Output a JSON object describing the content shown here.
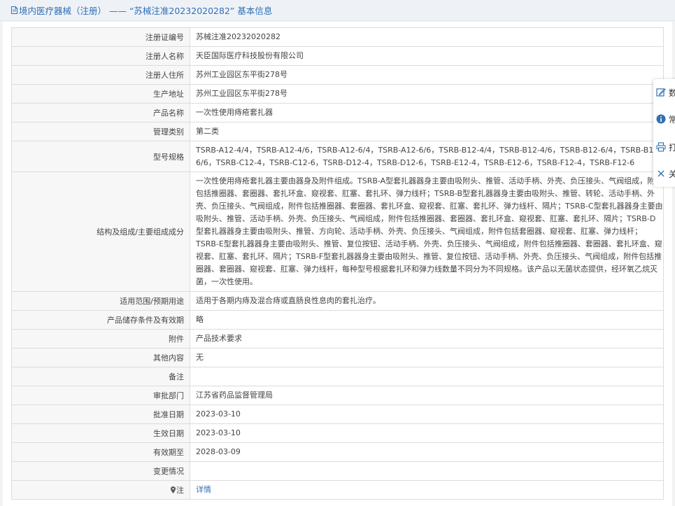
{
  "header": {
    "title": "境内医疗器械（注册） —— “苏械注准20232020282” 基本信息"
  },
  "rows": [
    {
      "label": "注册证编号",
      "value": "苏械注准20232020282"
    },
    {
      "label": "注册人名称",
      "value": "天臣国际医疗科技股份有限公司"
    },
    {
      "label": "注册人住所",
      "value": "苏州工业园区东平街278号"
    },
    {
      "label": "生产地址",
      "value": "苏州工业园区东平街278号"
    },
    {
      "label": "产品名称",
      "value": "一次性使用痔疮套扎器"
    },
    {
      "label": "管理类别",
      "value": "第二类"
    },
    {
      "label": "型号规格",
      "value": "TSRB-A12-4/4，TSRB-A12-4/6，TSRB-A12-6/4，TSRB-A12-6/6，TSRB-B12-4/4，TSRB-B12-4/6，TSRB-B12-6/4，TSRB-B12-6/6，TSRB-C12-4，TSRB-C12-6，TSRB-D12-4，TSRB-D12-6，TSRB-E12-4，TSRB-E12-6，TSRB-F12-4，TSRB-F12-6"
    },
    {
      "label": "结构及组成/主要组成成分",
      "value": "一次性使用痔疮套扎器主要由器身及附件组成。TSRB-A型套扎器器身主要由吸附头、推管、活动手柄、外壳、负压接头、气阀组成，附件包括推圈器、套圈器、套扎环盒、窥视套、肛塞、套扎环、弹力线杆；TSRB-B型套扎器器身主要由吸附头、推管、转轮、活动手柄、外壳、负压接头、气阀组成，附件包括推圈器、套圈器、套扎环盒、窥视套、肛塞、套扎环、弹力线杆、隔片；TSRB-C型套扎器器身主要由吸附头、推管、活动手柄、外壳、负压接头、气阀组成，附件包括推圈器、套圈器、套扎环盒、窥视套、肛塞、套扎环、隔片；TSRB-D型套扎器器身主要由吸附头、推管、方向轮、活动手柄、外壳、负压接头、气阀组成，附件包括套圈器、窥视套、肛塞、弹力线杆；TSRB-E型套扎器器身主要由吸附头、推管、复位按钮、活动手柄、外壳、负压接头、气阀组成，附件包括推圈器、套圈器、套扎环盒、窥视套、肛塞、套扎环、隔片；TSRB-F型套扎器器身主要由吸附头、推管、复位按钮、活动手柄、外壳、负压接头、气阀组成，附件包括推圈器、套圈器、窥视套、肛塞、弹力线杆，每种型号根据套扎环和弹力线数量不同分为不同规格。该产品以无菌状态提供，经环氧乙烷灭菌，一次性使用。"
    },
    {
      "label": "适用范围/预期用途",
      "value": "适用于各期内痔及混合痔或直肠良性息肉的套扎治疗。"
    },
    {
      "label": "产品储存条件及有效期",
      "value": "略"
    },
    {
      "label": "附件",
      "value": "产品技术要求"
    },
    {
      "label": "其他内容",
      "value": "无"
    },
    {
      "label": "备注",
      "value": ""
    },
    {
      "label": "审批部门",
      "value": "江苏省药品监督管理局"
    },
    {
      "label": "批准日期",
      "value": "2023-03-10"
    },
    {
      "label": "生效日期",
      "value": "2023-03-10"
    },
    {
      "label": "有效期至",
      "value": "2028-03-09"
    },
    {
      "label": "变更情况",
      "value": ""
    },
    {
      "label": "注",
      "value": "详情"
    }
  ],
  "side_toolbar": {
    "items": [
      {
        "icon": "edit-icon",
        "label": "数"
      },
      {
        "icon": "info-circle-icon",
        "label": "常"
      },
      {
        "icon": "print-icon",
        "label": "打"
      },
      {
        "icon": "close-icon",
        "label": "关"
      }
    ]
  },
  "colors": {
    "link": "#2f6fb4",
    "label_bg": "#f7f7f7",
    "border": "#dcdcdc",
    "header_bg": "#eef2f7"
  }
}
